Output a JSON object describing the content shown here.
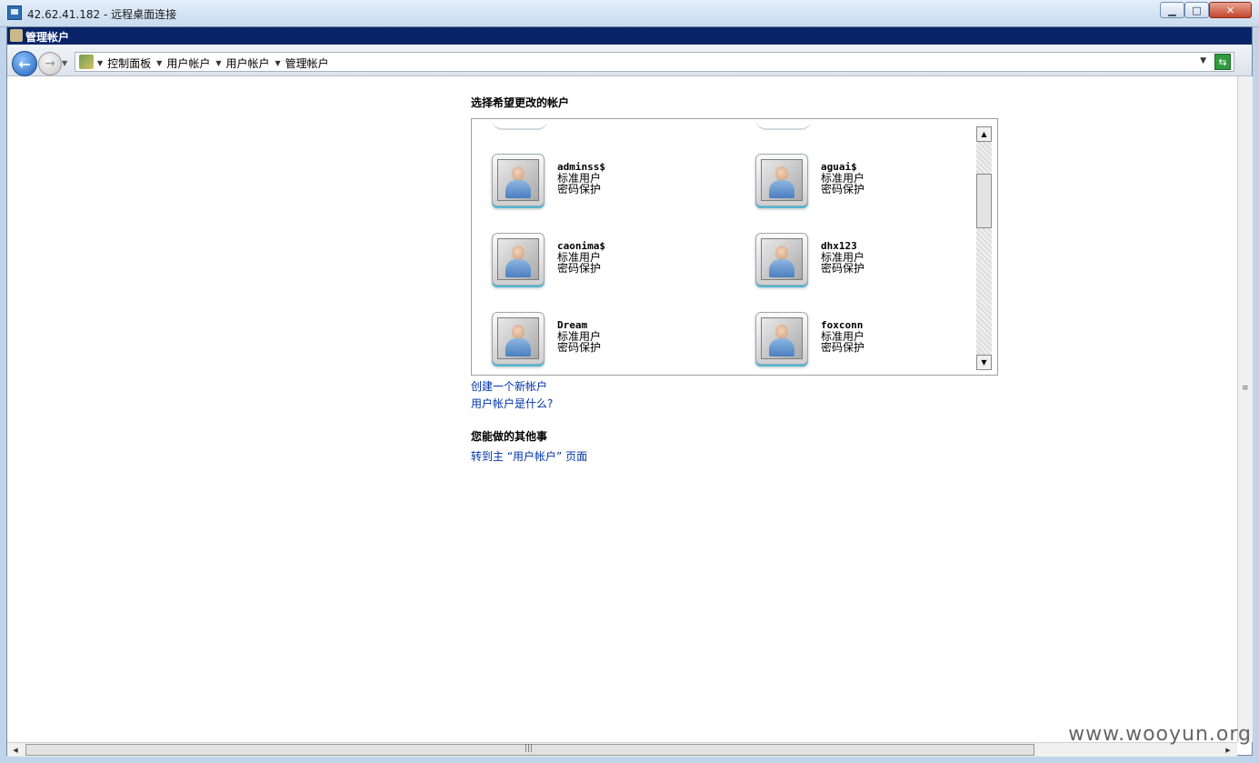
{
  "rdp": {
    "title": "42.62.41.182 - 远程桌面连接",
    "min_icon": "minimize-icon",
    "max_icon": "maximize-icon",
    "close_icon": "close-icon"
  },
  "window": {
    "title": "管理帐户"
  },
  "address": {
    "crumbs": [
      "控制面板",
      "用户帐户",
      "用户帐户",
      "管理帐户"
    ],
    "back_glyph": "←",
    "forward_glyph": "→",
    "dropdown_glyph": "▼",
    "go_glyph": "⇆"
  },
  "main": {
    "heading": "选择希望更改的帐户",
    "accounts": [
      {
        "name": "adminss$",
        "type": "标准用户",
        "protection": "密码保护"
      },
      {
        "name": "aguai$",
        "type": "标准用户",
        "protection": "密码保护"
      },
      {
        "name": "caonima$",
        "type": "标准用户",
        "protection": "密码保护"
      },
      {
        "name": "dhx123",
        "type": "标准用户",
        "protection": "密码保护"
      },
      {
        "name": "Dream",
        "type": "标准用户",
        "protection": "密码保护"
      },
      {
        "name": "foxconn",
        "type": "标准用户",
        "protection": "密码保护"
      }
    ],
    "links": {
      "create": "创建一个新帐户",
      "what_is": "用户帐户是什么?"
    },
    "other_heading": "您能做的其他事",
    "goto_link": "转到主 “用户帐户” 页面"
  },
  "watermark": "www.wooyun.org"
}
